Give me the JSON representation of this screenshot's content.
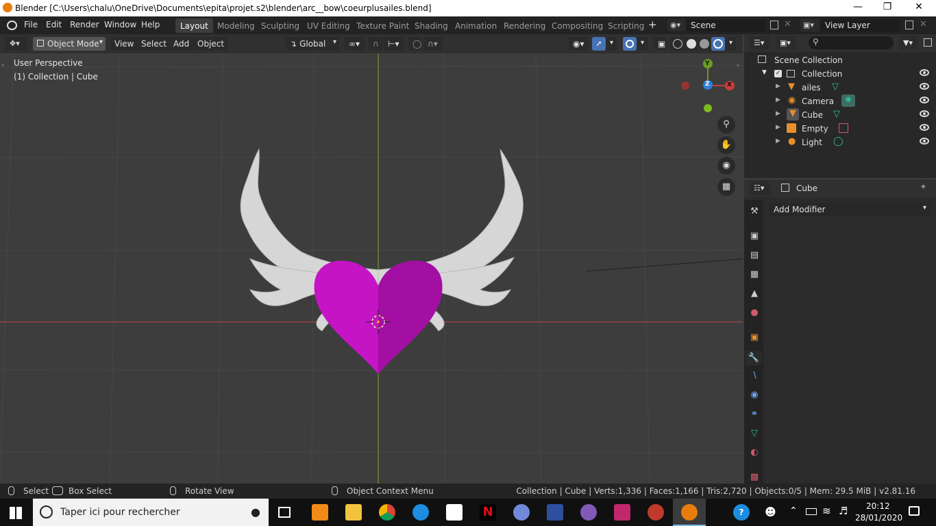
{
  "titlebar": {
    "title": "Blender [C:\\Users\\chalu\\OneDrive\\Documents\\epita\\projet.s2\\blender\\arc__bow\\coeurplusailes.blend]"
  },
  "menu": {
    "items": [
      "File",
      "Edit",
      "Render",
      "Window",
      "Help"
    ]
  },
  "workspaces": [
    "Layout",
    "Modeling",
    "Sculpting",
    "UV Editing",
    "Texture Paint",
    "Shading",
    "Animation",
    "Rendering",
    "Compositing",
    "Scripting"
  ],
  "scene": {
    "name": "Scene"
  },
  "view_layer": {
    "name": "View Layer"
  },
  "header3d": {
    "mode": "Object Mode",
    "view": "View",
    "select": "Select",
    "add": "Add",
    "object": "Object",
    "orientation": "Global"
  },
  "viewport": {
    "perspective": "User Perspective",
    "context": "(1) Collection | Cube",
    "gizmo_y": "Y",
    "gizmo_z": "Z",
    "gizmo_x": "X"
  },
  "outliner": {
    "root": "Scene Collection",
    "collection": "Collection",
    "items": [
      "ailes",
      "Camera",
      "Cube",
      "Empty",
      "Light"
    ]
  },
  "properties": {
    "object": "Cube",
    "add_modifier": "Add Modifier"
  },
  "statusbar": {
    "select": "Select",
    "box_select": "Box Select",
    "rotate": "Rotate View",
    "context_menu": "Object Context Menu",
    "stats": "Collection | Cube | Verts:1,336 | Faces:1,166 | Tris:2,720 | Objects:0/5 | Mem: 29.5 MiB | v2.81.16"
  },
  "taskbar": {
    "search_placeholder": "Taper ici pour rechercher",
    "time": "20:12",
    "date": "28/01/2020"
  },
  "colors": {
    "heart": "#c414c4",
    "wings": "#d8d8d8",
    "x_axis": "#c83c3c",
    "y_axis": "#6a9a24",
    "z_axis": "#2f7fd8",
    "accent": "#4772b3"
  }
}
